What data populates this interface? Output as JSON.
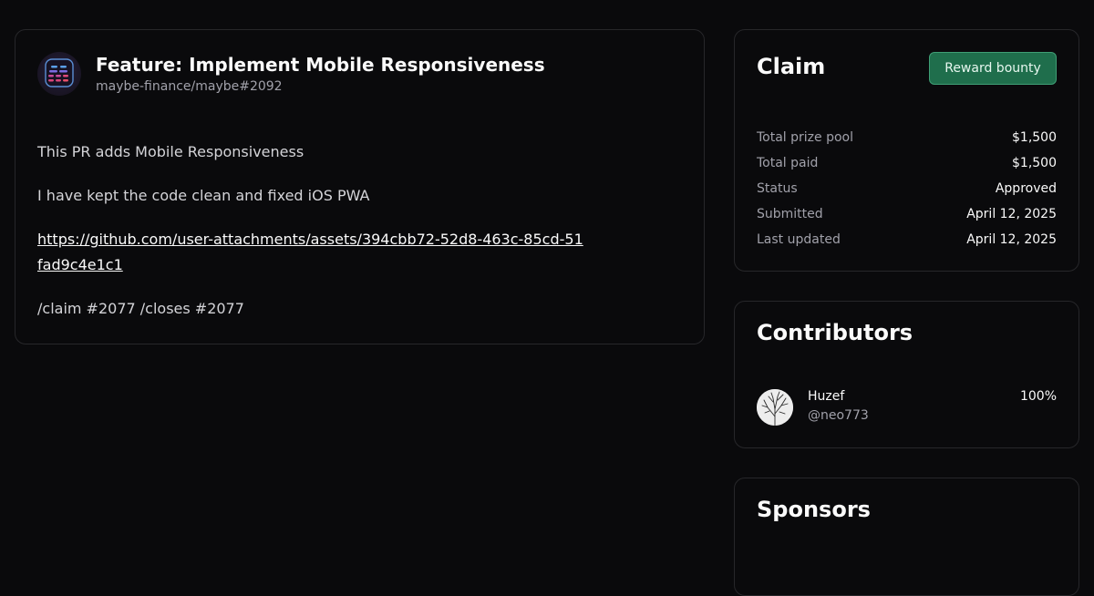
{
  "pull_request": {
    "title": "Feature: Implement Mobile Responsiveness",
    "repo_ref": "maybe-finance/maybe#2092",
    "body": {
      "line1": "This PR adds Mobile Responsiveness",
      "line2": "I have kept the code clean and fixed iOS PWA",
      "link": "https://github.com/user-attachments/assets/394cbb72-52d8-463c-85cd-51fad9c4e1c1",
      "line4": "/claim #2077 /closes #2077"
    }
  },
  "claim": {
    "title": "Claim",
    "reward_button": "Reward bounty",
    "stats": [
      {
        "label": "Total prize pool",
        "value": "$1,500"
      },
      {
        "label": "Total paid",
        "value": "$1,500"
      },
      {
        "label": "Status",
        "value": "Approved"
      },
      {
        "label": "Submitted",
        "value": "April 12, 2025"
      },
      {
        "label": "Last updated",
        "value": "April 12, 2025"
      }
    ]
  },
  "contributors": {
    "title": "Contributors",
    "items": [
      {
        "name": "Huzef",
        "handle": "@neo773",
        "share": "100%"
      }
    ]
  },
  "sponsors": {
    "title": "Sponsors"
  }
}
